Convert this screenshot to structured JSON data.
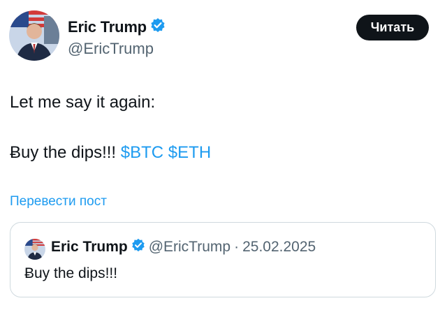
{
  "tweet": {
    "author": {
      "name": "Eric Trump",
      "handle": "@EricTrump"
    },
    "follow_label": "Читать",
    "text_line1": "Let me say it again:",
    "text_line2": "Ƀuy the dips!!!",
    "cashtags": [
      "$BTC",
      "$ETH"
    ],
    "translate_label": "Перевести пост"
  },
  "quote": {
    "author": {
      "name": "Eric Trump",
      "handle": "@EricTrump"
    },
    "separator": "·",
    "date": "25.02.2025",
    "text": "Ƀuy the dips!!!"
  },
  "icons": {
    "verified": "verified-badge-icon"
  },
  "colors": {
    "accent": "#1d9bf0",
    "text": "#0f1419",
    "secondary": "#536471",
    "button_bg": "#0f1419",
    "border": "#cfd9de"
  }
}
